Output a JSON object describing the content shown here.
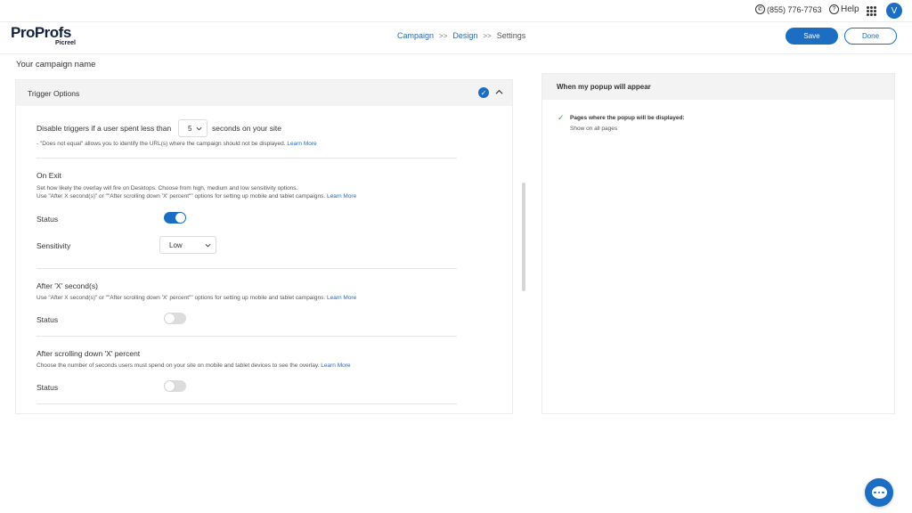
{
  "topbar": {
    "phone": "(855) 776-7763",
    "help": "Help",
    "avatar_initial": "V"
  },
  "header": {
    "logo_main": "ProProfs",
    "logo_sub": "Picreel",
    "breadcrumb": {
      "campaign": "Campaign",
      "sep1": ">>",
      "design": "Design",
      "sep2": ">>",
      "settings": "Settings"
    },
    "save_label": "Save",
    "done_label": "Done"
  },
  "campaign_name": "Your campaign name",
  "trigger": {
    "title": "Trigger Options",
    "disable_prefix": "Disable triggers if a user spent less than",
    "disable_value": "5",
    "disable_suffix": "seconds on your site",
    "disable_note": "- \"Does not equal\" allows you to identify the URL(s) where the campaign should not be displayed.",
    "learn_more": "Learn More",
    "on_exit": {
      "title": "On Exit",
      "desc1": "Set how likely the overlay will fire on Desktops. Choose from high, medium and low sensitivity options.",
      "desc2": "Use \"After X second(s)\" or \"\"After scrolling down 'X' percent\"\" options for setting up mobile and tablet campaigns.",
      "status_label": "Status",
      "status_on": true,
      "sensitivity_label": "Sensitivity",
      "sensitivity_value": "Low"
    },
    "after_seconds": {
      "title": "After 'X' second(s)",
      "desc": "Use \"After X second(s)\" or \"\"After scrolling down 'X' percent\"\" options for setting up mobile and tablet campaigns.",
      "status_label": "Status",
      "status_on": false
    },
    "after_scroll": {
      "title": "After scrolling down 'X' percent",
      "desc": "Choose the number of seconds users must spend on your site on mobile and tablet devices to see the overlay.",
      "status_label": "Status",
      "status_on": false
    }
  },
  "right_panel": {
    "title": "When my popup will appear",
    "pages_title": "Pages where the popup will be displayed:",
    "pages_value": "Show on all pages"
  },
  "colors": {
    "accent": "#1b6ec2",
    "link": "#2a6ab5",
    "check": "#3aa655"
  }
}
